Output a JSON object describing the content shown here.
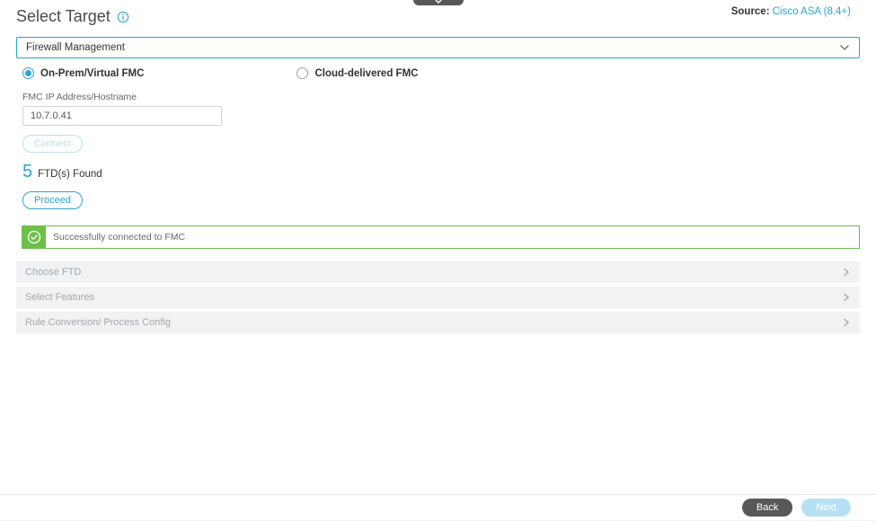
{
  "top_tab": {
    "icon": "collapse"
  },
  "source": {
    "label": "Source:",
    "link_text": "Cisco ASA (8.4+)"
  },
  "title": "Select Target",
  "target_select": {
    "value": "Firewall Management"
  },
  "radio": {
    "onprem": "On-Prem/Virtual FMC",
    "cloud": "Cloud-delivered FMC"
  },
  "fmc_field": {
    "label": "FMC IP Address/Hostname",
    "value": "10.7.0.41"
  },
  "buttons": {
    "connect": "Connect",
    "proceed": "Proceed"
  },
  "found": {
    "count": "5",
    "text": "FTD(s) Found"
  },
  "success": {
    "text": "Successfully connected to FMC"
  },
  "steps": {
    "choose_ftd": "Choose FTD",
    "select_features": "Select Features",
    "rule_conversion": "Rule Conversion/ Process Config"
  },
  "footer": {
    "back": "Back",
    "next": "Next"
  }
}
